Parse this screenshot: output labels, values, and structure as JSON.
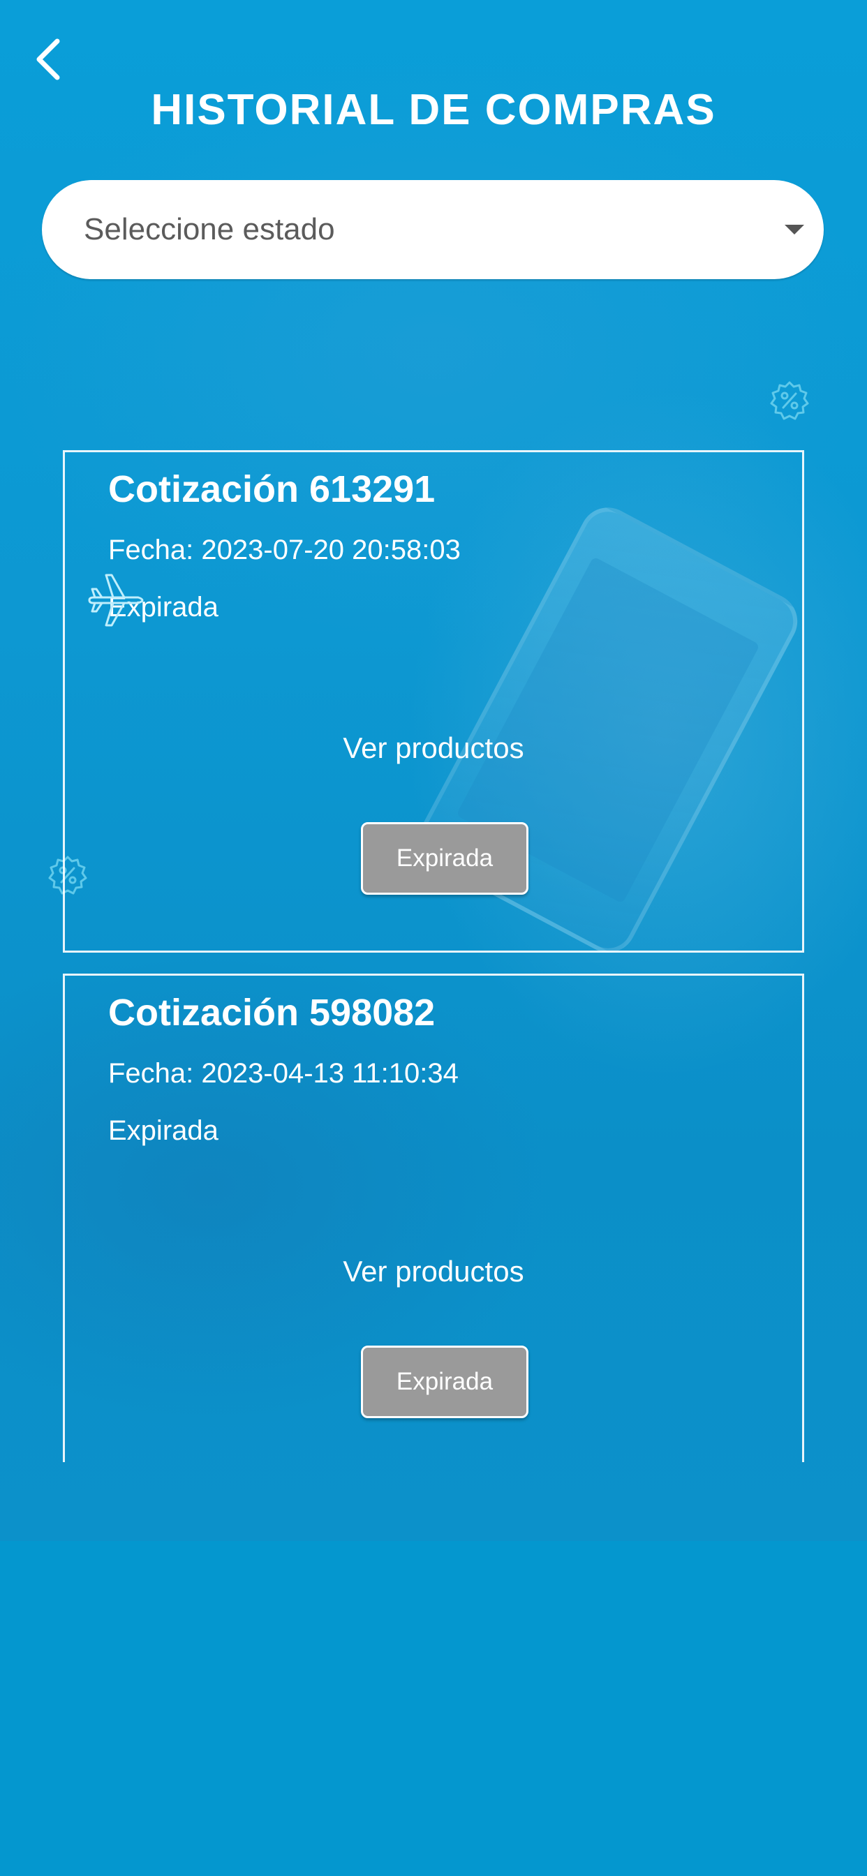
{
  "header": {
    "title": "HISTORIAL DE COMPRAS",
    "back_icon": "chevron-left-icon"
  },
  "filter": {
    "placeholder": "Seleccione estado",
    "arrow_icon": "caret-down-icon"
  },
  "orders": [
    {
      "title": "Cotización 613291",
      "date": "Fecha: 2023-07-20 20:58:03",
      "status": "Expirada",
      "link_label": "Ver productos",
      "button_label": "Expirada"
    },
    {
      "title": "Cotización 598082",
      "date": "Fecha: 2023-04-13 11:10:34",
      "status": "Expirada",
      "link_label": "Ver productos",
      "button_label": "Expirada"
    }
  ],
  "decorations": {
    "promo_icon": "discount-badge-icon",
    "plane_icon": "airplane-icon"
  },
  "colors": {
    "background": "#0497cf",
    "card_border": "#ffffff",
    "button_disabled": "#9a9a9a",
    "select_background": "#ffffff",
    "select_text": "#5b5b5b"
  }
}
